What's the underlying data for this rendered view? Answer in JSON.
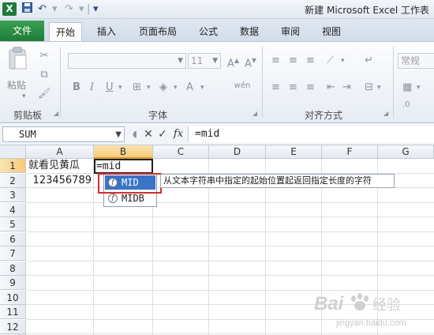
{
  "window": {
    "title": "新建 Microsoft Excel 工作表"
  },
  "tabs": {
    "file": "文件",
    "items": [
      "开始",
      "插入",
      "页面布局",
      "公式",
      "数据",
      "审阅",
      "视图"
    ]
  },
  "ribbon": {
    "clipboard": {
      "label": "剪贴板",
      "paste": "粘贴"
    },
    "font": {
      "label": "字体",
      "size": "11"
    },
    "alignment": {
      "label": "对齐方式"
    },
    "number": {
      "format": "常规"
    }
  },
  "formula_bar": {
    "name_box": "SUM",
    "cancel": "✕",
    "enter": "✓",
    "fx": "fx",
    "content": "=mid"
  },
  "grid": {
    "columns": [
      "A",
      "B",
      "C",
      "D",
      "E",
      "F",
      "G"
    ],
    "rows": [
      "1",
      "2",
      "3",
      "4",
      "5",
      "6",
      "7",
      "8",
      "9",
      "10",
      "11",
      "12",
      "13"
    ],
    "cells": {
      "A1": "就看见黄瓜",
      "A2": "123456789",
      "B1": "=mid"
    }
  },
  "autocomplete": {
    "items": [
      "MID",
      "MIDB"
    ],
    "selected": "MID",
    "tooltip": "从文本字符串中指定的起始位置起返回指定长度的字符"
  },
  "watermark": {
    "brand": "Bai",
    "brand_suffix": "经验",
    "url": "jingyan.baidu.com"
  },
  "colors": {
    "file_tab": "#1e7c38",
    "selection_header": "#f6c97a",
    "autocomplete_selected": "#3b73c6",
    "highlight_box": "#d42d2d"
  }
}
